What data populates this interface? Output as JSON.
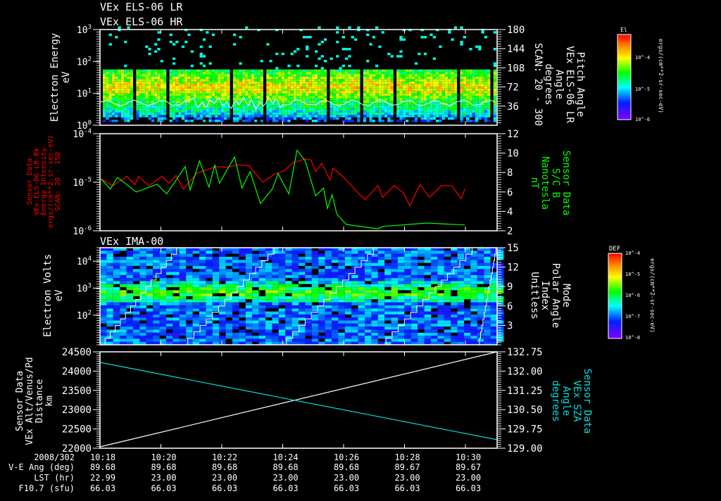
{
  "chart_data": [
    {
      "type": "heatmap",
      "title_lines": [
        "VEx ELS-06 LR",
        "VEx ELS-06 HR"
      ],
      "ylabel": [
        "Electron Energy",
        "eV"
      ],
      "yticks": [
        "10^0",
        "10^1",
        "10^2",
        "10^3"
      ],
      "ylim_log10": [
        0,
        3
      ],
      "right_axis": {
        "label": [
          "Pitch Angle",
          "VEx ELS-06 LR",
          "Angle",
          "degrees",
          "SCAN: 20 - 300"
        ],
        "ticks": [
          "180",
          "144",
          "108",
          "72",
          "36"
        ],
        "ylim": [
          0,
          180
        ]
      },
      "line_series": {
        "name": "pitch angle",
        "color": "#ffffff",
        "typical_value_eV": 5
      },
      "peak_energy_eV": 15,
      "colorbar": {
        "title": "El",
        "ticks": [
          "10^-4",
          "10^-5",
          "10^-6"
        ],
        "unit": "ergs/(cm**2-sr-sec-eV)"
      }
    },
    {
      "type": "line",
      "ylabel": [
        "Sensor Data",
        "VEx ELS-06 LR-Bk",
        "Energy Intensity",
        "ergs/(cm**2-sr-sec-eV)",
        "SCAN: 20 - 150"
      ],
      "yticks": [
        "10^-4",
        "10^-5",
        "10^-6"
      ],
      "ylim_log10": [
        -6,
        -4
      ],
      "right_axis": {
        "label": [
          "Sensor Data",
          "S/C B",
          "Nanotesla",
          "nT"
        ],
        "ticks": [
          "12",
          "10",
          "8",
          "6",
          "4",
          "2"
        ],
        "ylim": [
          2,
          12
        ]
      },
      "x_unit": "minutes after 10:18",
      "series": [
        {
          "name": "Energy Intensity",
          "color": "#ff0000",
          "axis": "left-log10",
          "x": [
            0.03,
            0.42,
            0.88,
            1.15,
            1.26,
            1.61,
            2.03,
            2.27,
            2.5,
            2.73,
            3.19,
            3.81,
            4.19,
            4.54,
            4.89,
            5.35,
            5.73,
            6.04,
            6.35,
            6.74,
            6.93,
            7.08,
            7.28,
            7.55,
            7.66,
            8.05,
            8.43,
            8.7,
            9.13,
            9.28,
            9.66,
            9.97,
            10.17,
            10.51,
            10.82,
            11.21,
            11.55,
            11.86,
            11.98
          ],
          "y": [
            -4.93,
            -5.07,
            -4.88,
            -5.05,
            -4.88,
            -5.07,
            -4.88,
            -5.02,
            -4.86,
            -5.14,
            -4.81,
            -4.68,
            -4.69,
            -4.64,
            -4.66,
            -5.0,
            -4.83,
            -4.77,
            -4.59,
            -4.52,
            -4.54,
            -4.78,
            -4.61,
            -4.95,
            -4.71,
            -4.93,
            -5.19,
            -5.36,
            -5.07,
            -5.31,
            -5.07,
            -5.22,
            -5.48,
            -5.05,
            -5.31,
            -5.07,
            -5.07,
            -5.34,
            -5.14
          ]
        },
        {
          "name": "S/C B",
          "color": "#00ff00",
          "axis": "right",
          "x": [
            0.03,
            0.34,
            0.57,
            1.19,
            1.88,
            2.19,
            2.8,
            2.96,
            3.27,
            3.58,
            3.77,
            3.92,
            4.42,
            4.66,
            4.93,
            5.27,
            5.66,
            5.85,
            6.2,
            6.47,
            6.74,
            7.08,
            7.34,
            7.47,
            7.62,
            7.78,
            8.09,
            9.13,
            9.28,
            10.74,
            11.98
          ],
          "y": [
            7.36,
            6.3,
            7.5,
            6.0,
            6.8,
            5.8,
            8.6,
            6.2,
            9.2,
            6.5,
            8.8,
            6.9,
            9.6,
            6.4,
            8.1,
            4.8,
            6.3,
            7.9,
            5.8,
            10.3,
            9.2,
            5.6,
            6.4,
            4.3,
            5.7,
            3.7,
            2.65,
            2.2,
            2.45,
            2.8,
            2.6
          ]
        }
      ]
    },
    {
      "type": "heatmap",
      "title": "VEx IMA-00",
      "ylabel": [
        "Electron Volts",
        "eV"
      ],
      "yticks": [
        "10^2",
        "10^3",
        "10^4"
      ],
      "ylim_log10": [
        0.9,
        4.5
      ],
      "right_axis": {
        "label": [
          "Mode",
          "Polar Angle",
          "Index",
          "Unitless"
        ],
        "ticks": [
          "15",
          "12",
          "9",
          "6",
          "3"
        ],
        "ylim": [
          0,
          15
        ]
      },
      "peak_energy_eV": 600,
      "colorbar": {
        "title": "DEF",
        "ticks": [
          "10^-4",
          "10^-5",
          "10^-6",
          "10^-7",
          "10^-8"
        ],
        "unit": "ergs/(cm**2-sr-sec-eV)"
      }
    },
    {
      "type": "line",
      "ylabel": [
        "Sensor Data",
        "VEx Alt/Venus/Pd",
        "Distance",
        "km"
      ],
      "yticks": [
        "24500",
        "24000",
        "23500",
        "23000",
        "22500",
        "22000"
      ],
      "ylim": [
        22000,
        24500
      ],
      "right_axis": {
        "label": [
          "Sensor Data",
          "VEx SZA",
          "Angle",
          "degrees"
        ],
        "ticks": [
          "132.75",
          "132.00",
          "131.25",
          "130.50",
          "129.75",
          "129.00"
        ],
        "ylim": [
          129.0,
          132.75
        ]
      },
      "series": [
        {
          "name": "Distance",
          "color": "#ffffff",
          "axis": "left",
          "x": [
            0,
            13.04
          ],
          "y": [
            22036,
            24500
          ]
        },
        {
          "name": "SZA",
          "color": "#00e0e0",
          "axis": "right",
          "x": [
            0,
            13.04
          ],
          "y": [
            132.34,
            129.33
          ]
        }
      ]
    }
  ],
  "time_axis": {
    "date": "2008/302",
    "ticks": [
      "10:18",
      "10:20",
      "10:22",
      "10:24",
      "10:26",
      "10:28",
      "10:30"
    ],
    "rows": [
      {
        "label": "V-E Ang (deg)",
        "values": [
          "89.68",
          "89.68",
          "89.68",
          "89.68",
          "89.68",
          "89.67",
          "89.67"
        ]
      },
      {
        "label": "LST (hr)",
        "values": [
          "22.99",
          "23.00",
          "23.00",
          "23.00",
          "23.00",
          "23.00",
          "23.00"
        ]
      },
      {
        "label": "F10.7 (sfu)",
        "values": [
          "66.03",
          "66.03",
          "66.03",
          "66.03",
          "66.03",
          "66.03",
          "66.03"
        ]
      }
    ]
  }
}
